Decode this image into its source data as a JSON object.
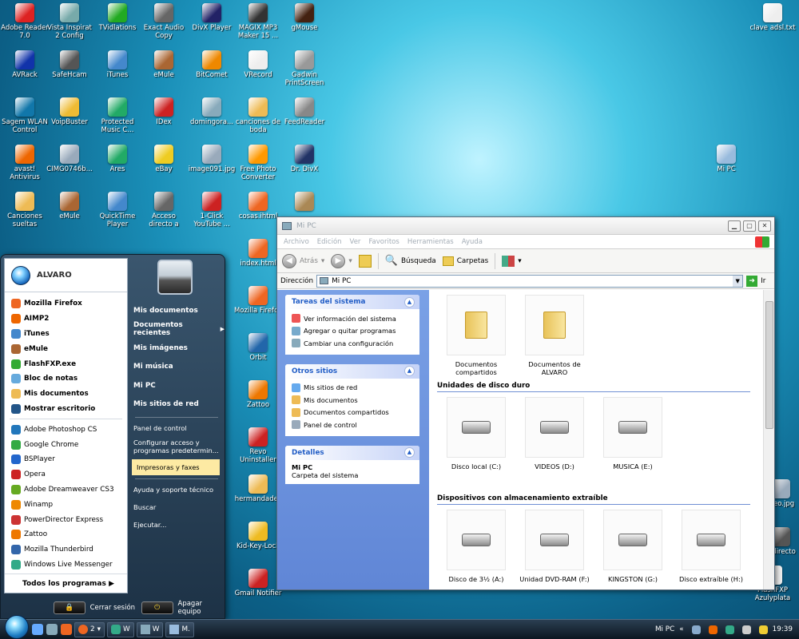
{
  "desktop_icons": [
    {
      "label": "Adobe Reader 7.0",
      "color": "#d22"
    },
    {
      "label": "Vista Inspirat 2 Config",
      "color": "#7aa"
    },
    {
      "label": "TVidlations",
      "color": "#2a2"
    },
    {
      "label": "Exact Audio Copy",
      "color": "#666"
    },
    {
      "label": "DivX Player",
      "color": "#226"
    },
    {
      "label": "MAGIX MP3 Maker 15 ...",
      "color": "#333"
    },
    {
      "label": "gMouse",
      "color": "#421"
    },
    {
      "label": "AVRack",
      "color": "#13a"
    },
    {
      "label": "SafeHcam",
      "color": "#555"
    },
    {
      "label": "iTunes",
      "color": "#48c"
    },
    {
      "label": "eMule",
      "color": "#a63"
    },
    {
      "label": "BitComet",
      "color": "#e80"
    },
    {
      "label": "VRecord",
      "color": "#eee"
    },
    {
      "label": "Gadwin PrintScreen",
      "color": "#999"
    },
    {
      "label": "Sagem WLAN Control Center",
      "color": "#17a"
    },
    {
      "label": "VoipBuster",
      "color": "#eb3"
    },
    {
      "label": "Protected Music C...",
      "color": "#2a6"
    },
    {
      "label": "IDex",
      "color": "#c22"
    },
    {
      "label": "domingora...",
      "color": "#8ab"
    },
    {
      "label": "canciones de boda",
      "color": "#eb5"
    },
    {
      "label": "FeedReader",
      "color": "#888"
    },
    {
      "label": "avast! Antivirus",
      "color": "#e60"
    },
    {
      "label": "CIMG0746b...",
      "color": "#9ab"
    },
    {
      "label": "Ares",
      "color": "#2a6"
    },
    {
      "label": "eBay",
      "color": "#ec2"
    },
    {
      "label": "image091.jpg",
      "color": "#9ab"
    },
    {
      "label": "Free Photo Converter",
      "color": "#f90"
    },
    {
      "label": "Dr. DivX",
      "color": "#236"
    },
    {
      "label": "Canciones sueltas",
      "color": "#eb5"
    },
    {
      "label": "eMule",
      "color": "#a63"
    },
    {
      "label": "QuickTime Player",
      "color": "#48c"
    },
    {
      "label": "Acceso directo a TMPGEnc...",
      "color": "#666"
    },
    {
      "label": "1-Click YouTube ...",
      "color": "#c22"
    },
    {
      "label": "cosas.ihtml",
      "color": "#e62"
    },
    {
      "label": "",
      "color": "#a85"
    },
    {
      "label": "index.html",
      "color": "#e62"
    },
    {
      "label": "Mozilla Firefox",
      "color": "#e62"
    },
    {
      "label": "Orbit",
      "color": "#26a"
    },
    {
      "label": "Zattoo",
      "color": "#e70"
    },
    {
      "label": "Revo Uninstaller",
      "color": "#c22"
    },
    {
      "label": "hermandades",
      "color": "#eb5"
    },
    {
      "label": "Kid-Key-Lock",
      "color": "#eb2"
    },
    {
      "label": "Gmail Notifier",
      "color": "#c22"
    },
    {
      "label": "clave adsl.txt",
      "color": "#eee"
    },
    {
      "label": "Mi PC",
      "color": "#9bd"
    },
    {
      "label": "...eo.jpg",
      "color": "#9ab"
    },
    {
      "label": "...directo",
      "color": "#555"
    },
    {
      "label": "FlashFXP Azulyplata",
      "color": "#eee"
    }
  ],
  "start_menu": {
    "user": "ALVARO",
    "pinned": [
      {
        "label": "Mozilla Firefox",
        "color": "#e62",
        "bold": true
      },
      {
        "label": "AIMP2",
        "color": "#e60",
        "bold": true
      },
      {
        "label": "iTunes",
        "color": "#48c",
        "bold": true
      },
      {
        "label": "eMule",
        "color": "#a63",
        "bold": true
      },
      {
        "label": "FlashFXP.exe",
        "color": "#3a3",
        "bold": true
      },
      {
        "label": "Bloc de notas",
        "color": "#6ad",
        "bold": true
      },
      {
        "label": "Mis documentos",
        "color": "#eb5",
        "bold": true
      },
      {
        "label": "Mostrar escritorio",
        "color": "#258",
        "bold": true
      }
    ],
    "recent": [
      {
        "label": "Adobe Photoshop CS",
        "color": "#27b"
      },
      {
        "label": "Google Chrome",
        "color": "#3a4"
      },
      {
        "label": "BSPlayer",
        "color": "#26c"
      },
      {
        "label": "Opera",
        "color": "#c22"
      },
      {
        "label": "Adobe Dreamweaver CS3",
        "color": "#6a2"
      },
      {
        "label": "Winamp",
        "color": "#e80"
      },
      {
        "label": "PowerDirector Express",
        "color": "#c33"
      },
      {
        "label": "Zattoo",
        "color": "#e70"
      },
      {
        "label": "Mozilla Thunderbird",
        "color": "#36a"
      },
      {
        "label": "Windows Live Messenger",
        "color": "#3a8"
      }
    ],
    "all_programs": "Todos los programas",
    "right": {
      "mis_documentos": "Mis documentos",
      "documentos_recientes": "Documentos recientes",
      "mis_imagenes": "Mis imágenes",
      "mi_musica": "Mi música",
      "mi_pc": "Mi PC",
      "mis_sitios": "Mis sitios de red",
      "panel": "Panel de control",
      "configurar": "Configurar acceso y programas predetermin...",
      "impresoras": "Impresoras y faxes",
      "ayuda": "Ayuda y soporte técnico",
      "buscar": "Buscar",
      "ejecutar": "Ejecutar..."
    },
    "cerrar": "Cerrar sesión",
    "apagar": "Apagar equipo"
  },
  "explorer": {
    "title": "Mi PC",
    "menu": [
      "Archivo",
      "Edición",
      "Ver",
      "Favoritos",
      "Herramientas",
      "Ayuda"
    ],
    "back": "Atrás",
    "search": "Búsqueda",
    "folders": "Carpetas",
    "address_label": "Dirección",
    "address": "Mi PC",
    "go": "Ir",
    "tasks_title": "Tareas del sistema",
    "tasks": [
      "Ver información del sistema",
      "Agregar o quitar programas",
      "Cambiar una configuración"
    ],
    "places_title": "Otros sitios",
    "places": [
      "Mis sitios de red",
      "Mis documentos",
      "Documentos compartidos",
      "Panel de control"
    ],
    "details_title": "Detalles",
    "details_name": "Mi PC",
    "details_desc": "Carpeta del sistema",
    "folders_items": [
      "Documentos compartidos",
      "Documentos de ALVARO"
    ],
    "hdd_title": "Unidades de disco duro",
    "hdd": [
      "Disco local (C:)",
      "VIDEOS (D:)",
      "MUSICA (E:)"
    ],
    "removable_title": "Dispositivos con almacenamiento extraíble",
    "removable": [
      "Disco de 3½ (A:)",
      "Unidad DVD-RAM (F:)",
      "KINGSTON (G:)",
      "Disco extraíble (H:)"
    ]
  },
  "taskbar": {
    "btn1": "2",
    "btn2": "W",
    "btn3": "W",
    "btn4": "M.",
    "tray_label": "Mi PC",
    "clock": "19:39"
  }
}
